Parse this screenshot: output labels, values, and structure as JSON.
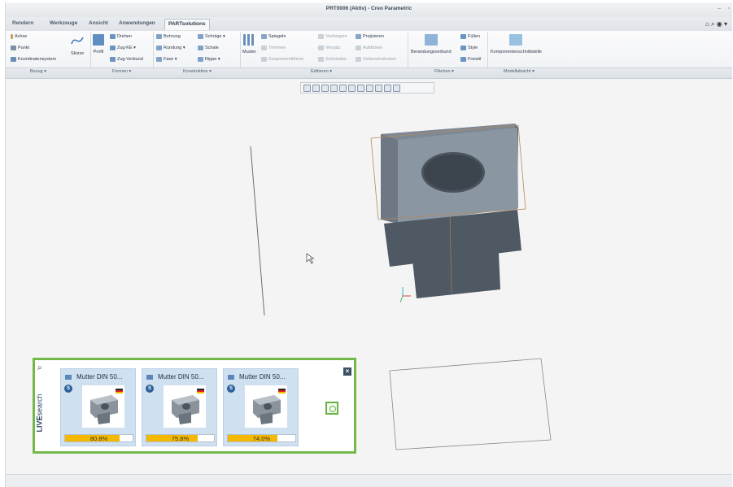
{
  "window": {
    "title": "PRT0006 (Aktiv) - Creo Parametric",
    "controls": [
      "–",
      "▫"
    ],
    "right_tools": [
      "⌂",
      "⌕",
      "◉",
      "▾"
    ]
  },
  "tabs": [
    {
      "label": "Rendern",
      "active": false
    },
    {
      "label": "Werkzeuge",
      "active": false
    },
    {
      "label": "Ansicht",
      "active": false
    },
    {
      "label": "Anwendungen",
      "active": false
    },
    {
      "label": "PARTsolutions",
      "active": true
    }
  ],
  "ribbon": {
    "bezug": {
      "items": [
        "Achse",
        "Punkt",
        "Koordinatensystem"
      ],
      "skizze": "Skizze",
      "group": "Bezug ▾"
    },
    "formen": {
      "profil": "Profil",
      "items": [
        "Drehen",
        "Zug-KE ▾",
        "Zug-Verbund"
      ],
      "group": "Formen ▾"
    },
    "konstruktion": {
      "items": [
        "Bohrung",
        "Rundung ▾",
        "Fase ▾",
        "Schräge ▾",
        "Schale",
        "Rippe ▾"
      ],
      "group": "Konstruktion ▾"
    },
    "muster": {
      "label": "Muster"
    },
    "editieren": {
      "items": [
        "Spiegeln",
        "Trimmen",
        "Zusammenführen",
        "Verlängern",
        "Versatz",
        "Schneiden",
        "Projizieren",
        "Aufdicken",
        "Verbundvolumen"
      ],
      "group": "Editieren ▾"
    },
    "flaechen": {
      "items": [
        "Berandungsverbund",
        "Füllen",
        "Style",
        "Freistil"
      ],
      "group": "Flächen ▾"
    },
    "modellabsicht": {
      "items": [
        "Komponentenschnittstelle"
      ],
      "group": "Modellabsicht ▾"
    }
  },
  "livesearch": {
    "logo_live": "LIVE",
    "logo_search": "search",
    "close": "×",
    "results": [
      {
        "title": "Mutter DIN 50...",
        "percent": "80.8%",
        "value": 0.808
      },
      {
        "title": "Mutter DIN 50...",
        "percent": "75.8%",
        "value": 0.758
      },
      {
        "title": "Mutter DIN 50...",
        "percent": "74.0%",
        "value": 0.74
      }
    ]
  },
  "colors": {
    "live_border": "#74b84a",
    "progress": "#f4b800",
    "card": "#cfe1f1",
    "model_top": "#8b96a3",
    "model_side": "#55606c"
  }
}
